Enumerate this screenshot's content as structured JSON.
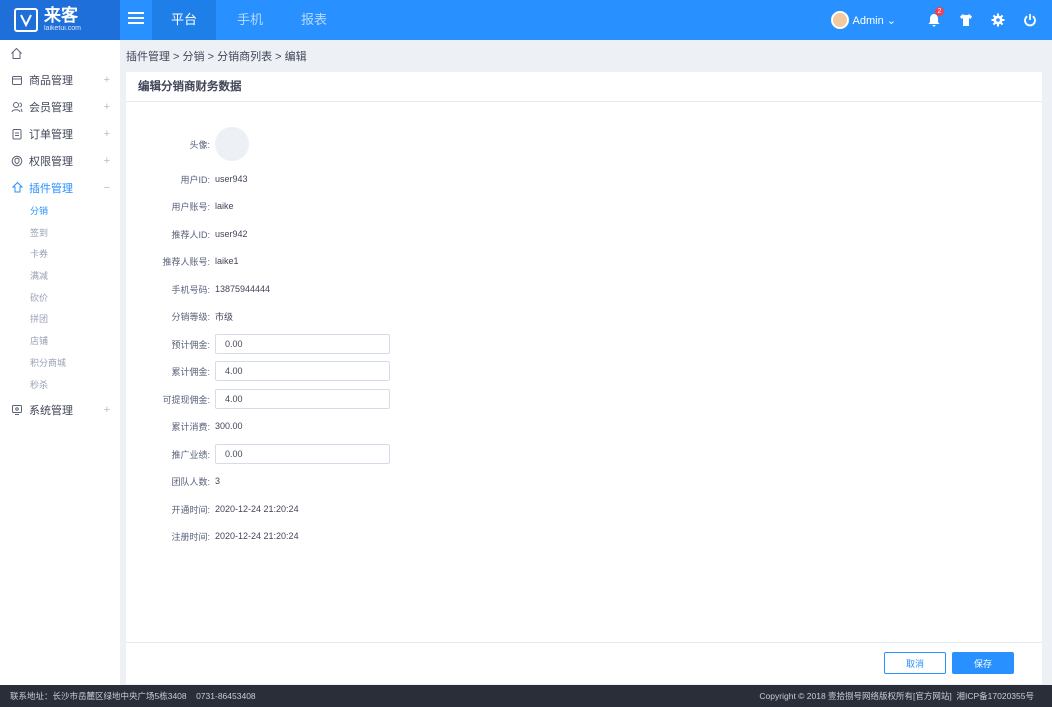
{
  "brand": {
    "name": "来客",
    "domain": "laiketui.com"
  },
  "topnav": {
    "tabs": [
      {
        "label": "平台"
      },
      {
        "label": "手机"
      },
      {
        "label": "报表"
      }
    ]
  },
  "user": {
    "name": "Admin",
    "notification_count": "2"
  },
  "sidebar": {
    "items": [
      {
        "label": "商品管理",
        "icon": "box-icon"
      },
      {
        "label": "会员管理",
        "icon": "users-icon"
      },
      {
        "label": "订单管理",
        "icon": "clipboard-icon"
      },
      {
        "label": "权限管理",
        "icon": "shield-icon"
      },
      {
        "label": "插件管理",
        "icon": "puzzle-icon"
      },
      {
        "label": "系统管理",
        "icon": "monitor-icon"
      }
    ],
    "sub_items": [
      "分销",
      "签到",
      "卡券",
      "满减",
      "砍价",
      "拼团",
      "店铺",
      "积分商城",
      "秒杀"
    ]
  },
  "breadcrumb": "插件管理 > 分销 > 分销商列表 > 编辑",
  "page": {
    "title": "编辑分销商财务数据",
    "fields": {
      "avatar_label": "头像:",
      "user_id_label": "用户ID:",
      "user_id": "user943",
      "account_label": "用户账号:",
      "account": "laike",
      "referrer_id_label": "推荐人ID:",
      "referrer_id": "user942",
      "referrer_account_label": "推荐人账号:",
      "referrer_account": "laike1",
      "phone_label": "手机号码:",
      "phone": "13875944444",
      "level_label": "分销等级:",
      "level": "市级",
      "est_commission_label": "预计佣金:",
      "est_commission": "0.00",
      "total_commission_label": "累计佣金:",
      "total_commission": "4.00",
      "withdrawable_label": "可提现佣金:",
      "withdrawable": "4.00",
      "total_consumption_label": "累计消费:",
      "total_consumption": "300.00",
      "promo_perf_label": "推广业绩:",
      "promo_perf": "0.00",
      "team_size_label": "团队人数:",
      "team_size": "3",
      "open_time_label": "开通时间:",
      "open_time": "2020-12-24 21:20:24",
      "reg_time_label": "注册时间:",
      "reg_time": "2020-12-24 21:20:24"
    },
    "cancel_label": "取消",
    "save_label": "保存"
  },
  "footer": {
    "left": "联系地址：长沙市岳麓区绿地中央广场5栋3408    0731-86453408",
    "right": "Copyright © 2018 壹拾捌号网络版权所有[官方网站]  湘ICP备17020355号"
  }
}
